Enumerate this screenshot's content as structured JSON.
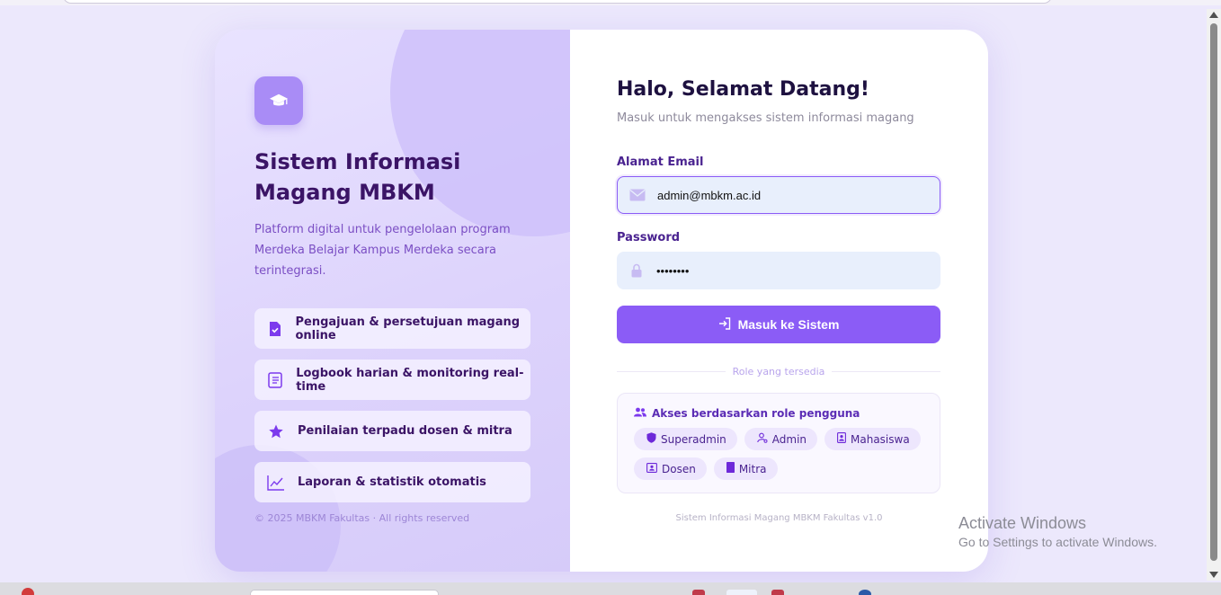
{
  "brand": {
    "title": "Sistem Informasi Magang MBKM",
    "description": "Platform digital untuk pengelolaan program Merdeka Belajar Kampus Merdeka secara terintegrasi.",
    "logo_icon": "graduation-cap-icon",
    "accent_color": "#8b5cf6"
  },
  "features": [
    {
      "label": "Pengajuan & persetujuan magang online",
      "icon": "file-check-icon"
    },
    {
      "label": "Logbook harian & monitoring real-time",
      "icon": "logbook-icon"
    },
    {
      "label": "Penilaian terpadu dosen & mitra",
      "icon": "star-icon"
    },
    {
      "label": "Laporan & statistik otomatis",
      "icon": "chart-line-icon"
    }
  ],
  "copyright": "© 2025 MBKM Fakultas · All rights reserved",
  "login": {
    "title": "Halo, Selamat Datang!",
    "subtitle": "Masuk untuk mengakses sistem informasi magang",
    "email_label": "Alamat Email",
    "email_value": "admin@mbkm.ac.id",
    "password_label": "Password",
    "password_value": "••••••••",
    "submit_label": "Masuk ke Sistem"
  },
  "roles": {
    "divider_text": "Role yang tersedia",
    "heading": "Akses berdasarkan role pengguna",
    "items": [
      {
        "label": "Superadmin",
        "icon": "shield-icon"
      },
      {
        "label": "Admin",
        "icon": "user-gear-icon"
      },
      {
        "label": "Mahasiswa",
        "icon": "id-badge-icon"
      },
      {
        "label": "Dosen",
        "icon": "id-card-icon"
      },
      {
        "label": "Mitra",
        "icon": "building-icon"
      }
    ]
  },
  "footer_version": "Sistem Informasi Magang MBKM Fakultas v1.0",
  "watermark": {
    "line1": "Activate Windows",
    "line2": "Go to Settings to activate Windows."
  }
}
